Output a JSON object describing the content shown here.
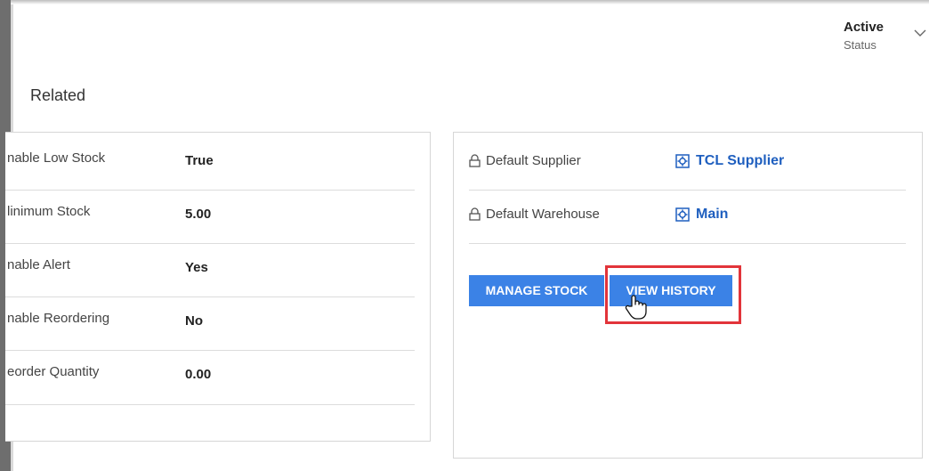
{
  "header": {
    "status_value": "Active",
    "status_label": "Status"
  },
  "tabs": {
    "related": "Related"
  },
  "left_fields": [
    {
      "label": "nable Low Stock",
      "value": "True"
    },
    {
      "label": "linimum Stock",
      "value": "5.00"
    },
    {
      "label": "nable Alert",
      "value": "Yes"
    },
    {
      "label": "nable Reordering",
      "value": "No"
    },
    {
      "label": "eorder Quantity",
      "value": "0.00"
    }
  ],
  "lookups": [
    {
      "label": "Default Supplier",
      "link": "TCL Supplier"
    },
    {
      "label": "Default Warehouse",
      "link": "Main"
    }
  ],
  "buttons": {
    "manage_stock": "MANAGE STOCK",
    "view_history": "VIEW HISTORY"
  },
  "colors": {
    "accent": "#3b82e6",
    "link": "#1f5fbf",
    "highlight": "#e2343a"
  },
  "icons": [
    "lock-icon",
    "entity-icon",
    "chevron-down-icon",
    "hand-cursor-icon"
  ]
}
